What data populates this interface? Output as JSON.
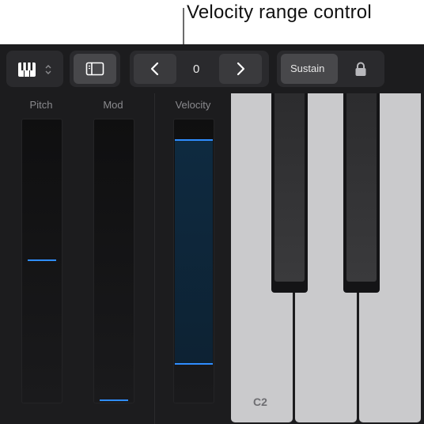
{
  "callout": {
    "text": "Velocity range control"
  },
  "toolbar": {
    "keyboard_icon": "piano-keys-icon",
    "chevron_icon": "up-down-chevron-icon",
    "panel_icon": "sidebar-panel-icon",
    "prev_icon": "chevron-left-icon",
    "next_icon": "chevron-right-icon",
    "octave_value": "0",
    "sustain_label": "Sustain",
    "lock_icon": "lock-icon"
  },
  "controls": {
    "pitch": {
      "label": "Pitch",
      "value": 0.5
    },
    "mod": {
      "label": "Mod",
      "value": 0.0
    },
    "velocity": {
      "label": "Velocity",
      "range_high": 0.93,
      "range_low": 0.13
    }
  },
  "keyboard": {
    "c2_label": "C2"
  },
  "colors": {
    "accent": "#2f8dff",
    "background": "#1c1c1e",
    "white_key": "#cacacc"
  }
}
